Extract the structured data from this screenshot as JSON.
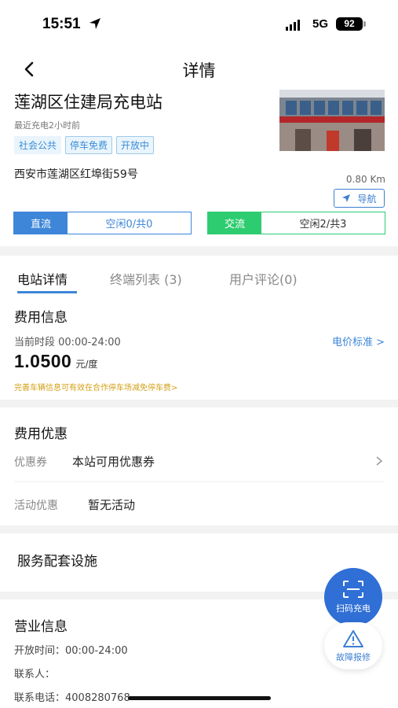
{
  "status_bar": {
    "time": "15:51",
    "network": "5G",
    "battery": "92"
  },
  "header": {
    "title": "详情"
  },
  "station": {
    "name": "莲湖区住建局充电站",
    "last_charge": "最近充电2小时前",
    "tags": [
      "社会公共",
      "停车免费",
      "开放中"
    ],
    "address": "西安市莲湖区红埠街59号",
    "distance": "0.80 Km",
    "navigate_label": "导航"
  },
  "ports": {
    "dc": {
      "type": "直流",
      "status": "空闲0/共0"
    },
    "ac": {
      "type": "交流",
      "status": "空闲2/共3"
    }
  },
  "tabs": [
    "电站详情",
    "终端列表 (3)",
    "用户评论(0)"
  ],
  "fee": {
    "title": "费用信息",
    "period": "当前时段 00:00-24:00",
    "price_link": "电价标准 >",
    "price": "1.0500",
    "unit": "元/度",
    "note": "完善车辆信息可有效在合作停车场减免停车费>"
  },
  "discount": {
    "title": "费用优惠",
    "coupon_label": "优惠券",
    "coupon_value": "本站可用优惠券",
    "activity_label": "活动优惠",
    "activity_value": "暂无活动"
  },
  "facilities": {
    "title": "服务配套设施"
  },
  "business": {
    "title": "营业信息",
    "hours": "开放时间：00:00-24:00",
    "contact": "联系人：",
    "phone": "联系电话：4008280768"
  },
  "fab": {
    "scan": "扫码充电",
    "repair": "故障报修"
  },
  "colors": {
    "accent": "#3d86d8",
    "dc": "#3d86d8",
    "ac": "#2ecc71",
    "note": "#d4a017"
  }
}
